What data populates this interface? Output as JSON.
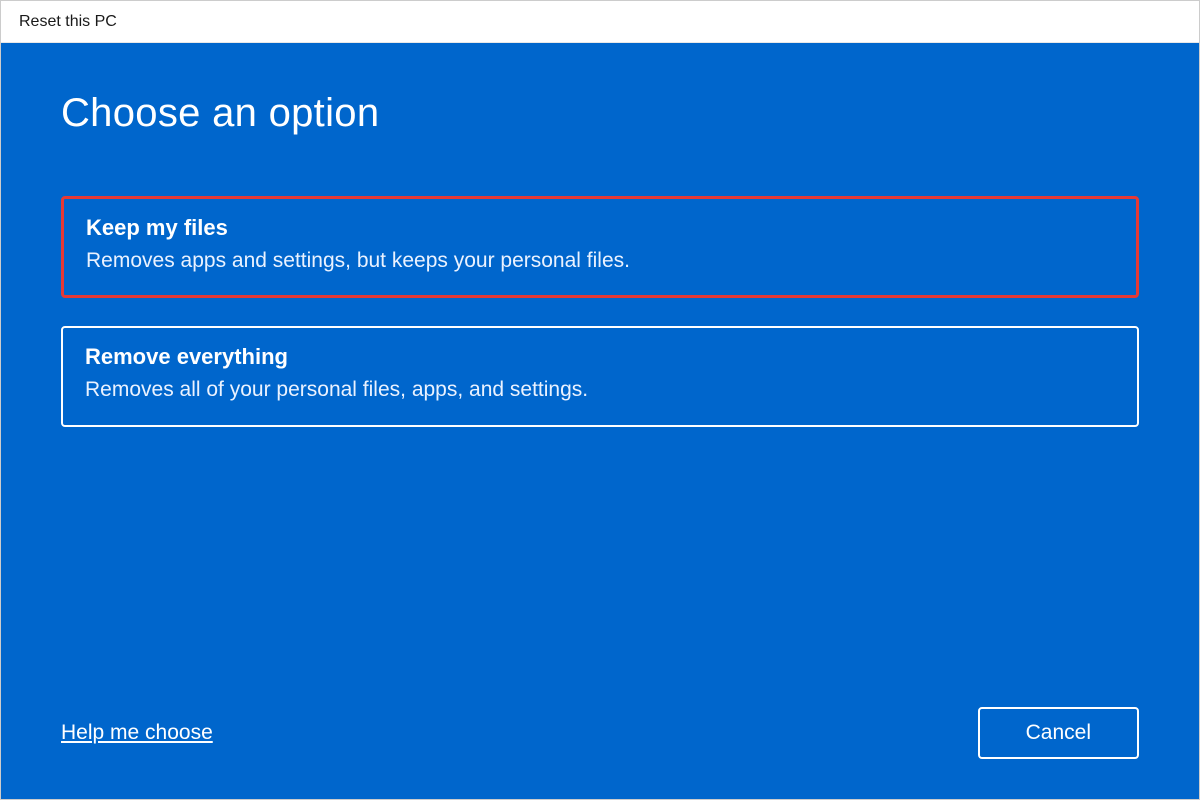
{
  "window": {
    "title": "Reset this PC"
  },
  "main": {
    "heading": "Choose an option",
    "options": [
      {
        "title": "Keep my files",
        "description": "Removes apps and settings, but keeps your personal files.",
        "highlighted": true
      },
      {
        "title": "Remove everything",
        "description": "Removes all of your personal files, apps, and settings.",
        "highlighted": false
      }
    ]
  },
  "footer": {
    "help_link": "Help me choose",
    "cancel_label": "Cancel"
  }
}
